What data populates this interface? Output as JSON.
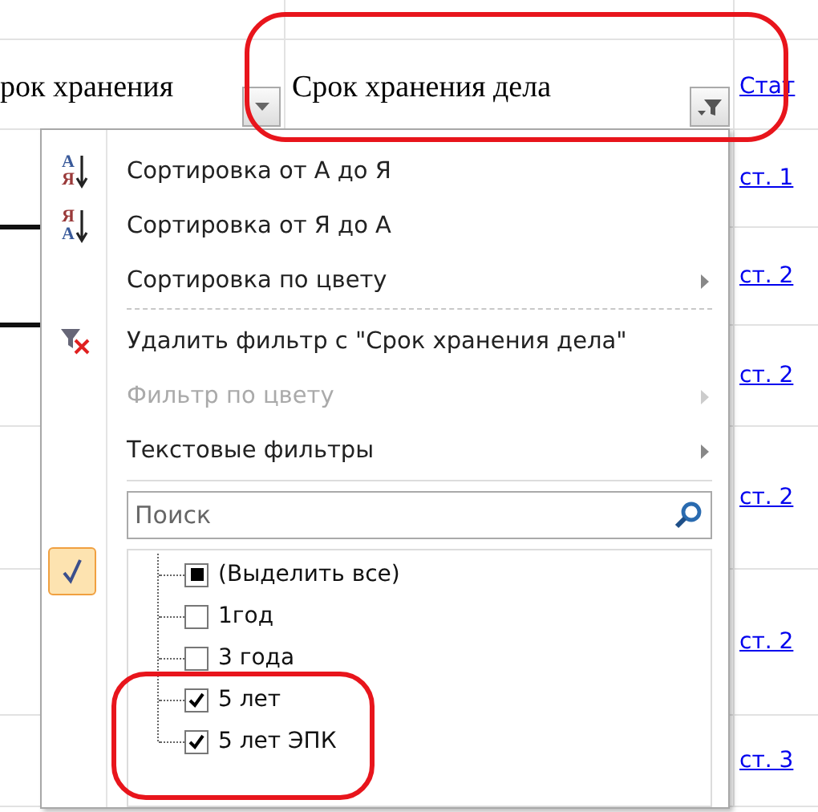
{
  "sheet": {
    "headers": [
      {
        "kind": "filter",
        "text": "рок хранения",
        "filter_active": false
      },
      {
        "kind": "filter",
        "text": "Срок хранения дела",
        "filter_active": true
      },
      {
        "kind": "link",
        "text": "Стат"
      }
    ],
    "links": [
      "ст. 1",
      "ст. 2",
      "ст. 2",
      "ст. 2",
      "ст. 2",
      "ст. 3"
    ]
  },
  "menu": {
    "items": [
      {
        "kind": "sort-asc",
        "icon_text": [
          "A",
          "Я"
        ],
        "label": "Сортировка от А до Я",
        "disabled": false,
        "submenu": false
      },
      {
        "kind": "sort-desc",
        "icon_text": [
          "Я",
          "A"
        ],
        "label": "Сортировка от Я до А",
        "disabled": false,
        "submenu": false
      },
      {
        "kind": "plain",
        "label": "Сортировка по цвету",
        "disabled": false,
        "submenu": true
      },
      {
        "kind": "separator",
        "dashed": true
      },
      {
        "kind": "clear-filter",
        "label": "Удалить фильтр с \"Срок хранения дела\"",
        "disabled": false,
        "submenu": false
      },
      {
        "kind": "plain",
        "label": "Фильтр по цвету",
        "disabled": true,
        "submenu": true
      },
      {
        "kind": "plain",
        "label": "Текстовые фильтры",
        "disabled": false,
        "submenu": true
      },
      {
        "kind": "separator",
        "dashed": false
      }
    ],
    "filter_check": {
      "on": true
    },
    "search": {
      "placeholder": "Поиск"
    },
    "options": [
      {
        "label": "(Выделить все)",
        "checked": true,
        "mixed": true
      },
      {
        "label": "1год",
        "checked": false,
        "mixed": false
      },
      {
        "label": "3 года",
        "checked": false,
        "mixed": false
      },
      {
        "label": "5 лет",
        "checked": true,
        "mixed": false
      },
      {
        "label": "5 лет ЭПК",
        "checked": true,
        "mixed": false
      }
    ]
  }
}
